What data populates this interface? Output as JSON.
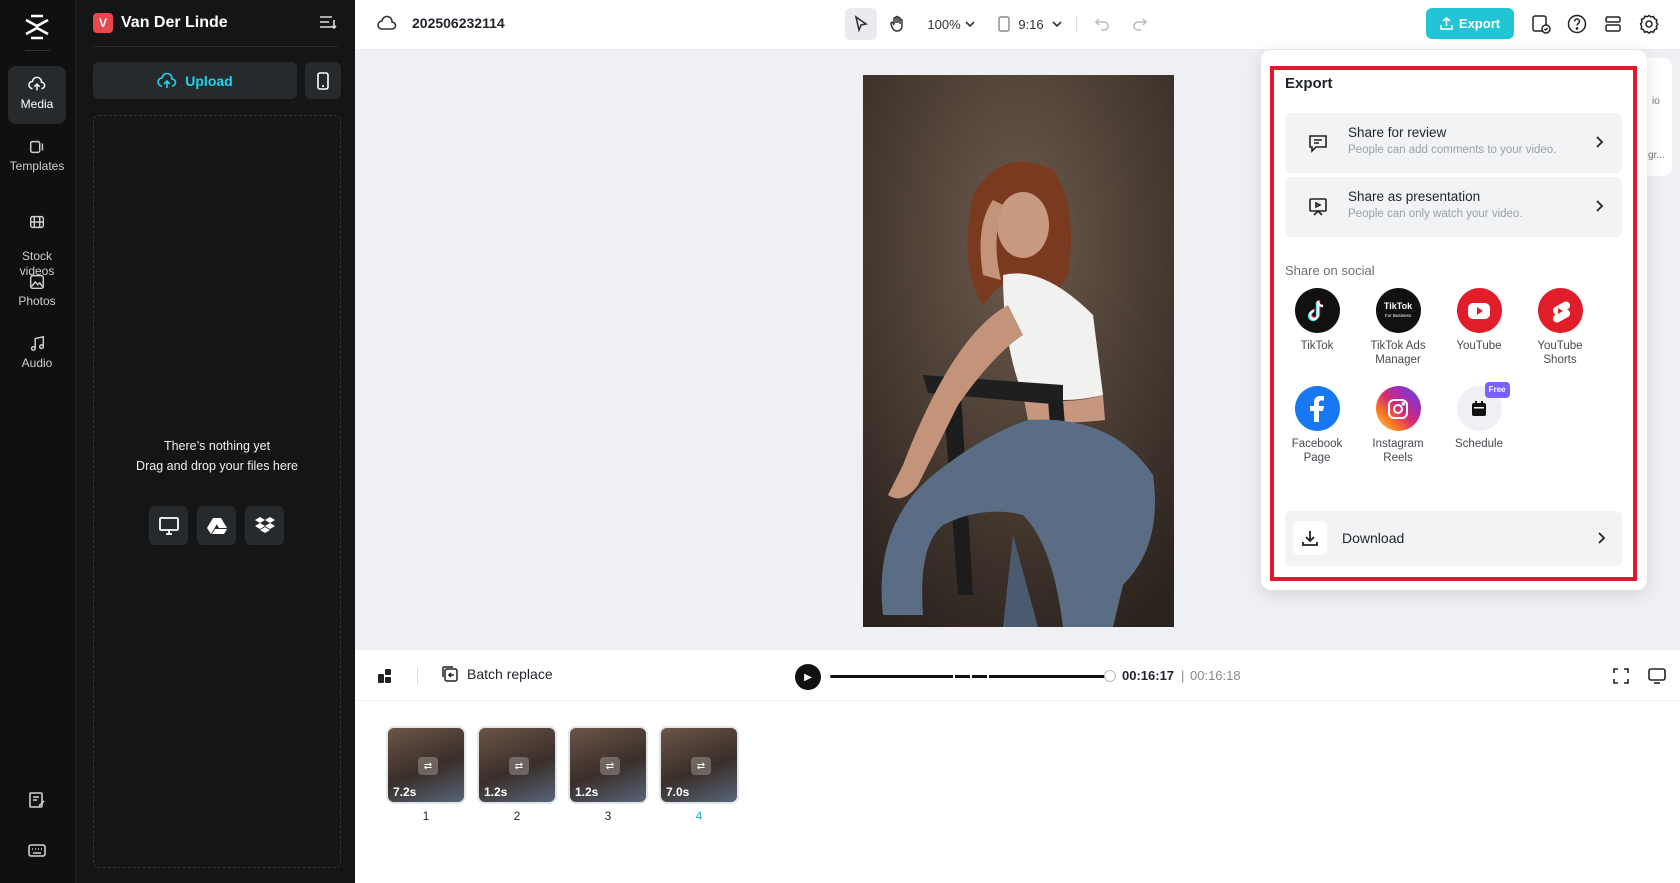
{
  "app": {
    "project_name": "Van Der Linde",
    "project_badge": "V",
    "project_id": "202506232114"
  },
  "sidebar": {
    "items": [
      {
        "label": "Media",
        "icon": "media-upload-icon",
        "active": true
      },
      {
        "label": "Templates",
        "icon": "templates-icon"
      },
      {
        "label": "Stock\nvideos",
        "icon": "film-icon"
      },
      {
        "label": "Photos",
        "icon": "image-icon"
      },
      {
        "label": "Audio",
        "icon": "music-note-icon"
      }
    ]
  },
  "media_panel": {
    "upload_label": "Upload",
    "empty_line1": "There’s nothing yet",
    "empty_line2": "Drag and drop your files here"
  },
  "toolbar": {
    "zoom": "100%",
    "aspect": "9:16",
    "export_label": "Export"
  },
  "player": {
    "batch_replace": "Batch replace",
    "current_time": "00:16:17",
    "total_time": "00:16:18"
  },
  "timeline": {
    "clips": [
      {
        "duration": "7.2s",
        "index": "1"
      },
      {
        "duration": "1.2s",
        "index": "2"
      },
      {
        "duration": "1.2s",
        "index": "3"
      },
      {
        "duration": "7.0s",
        "index": "4",
        "selected": true
      }
    ]
  },
  "side_peek": {
    "label1": "io",
    "label2": "gr..."
  },
  "export_panel": {
    "title": "Export",
    "review": {
      "title": "Share for review",
      "subtitle": "People can add comments to your video."
    },
    "presentation": {
      "title": "Share as presentation",
      "subtitle": "People can only watch your video."
    },
    "social_heading": "Share on social",
    "social": [
      {
        "label": "TikTok",
        "icon": "tiktok-icon"
      },
      {
        "label": "TikTok Ads Manager",
        "icon": "tiktok-ads-icon",
        "badge_text": "TikTok",
        "badge_sub": "For Business"
      },
      {
        "label": "YouTube",
        "icon": "youtube-icon"
      },
      {
        "label": "YouTube Shorts",
        "icon": "youtube-shorts-icon"
      },
      {
        "label": "Facebook Page",
        "icon": "facebook-icon"
      },
      {
        "label": "Instagram Reels",
        "icon": "instagram-icon"
      },
      {
        "label": "Schedule",
        "icon": "calendar-icon",
        "badge": "Free"
      }
    ],
    "download_label": "Download"
  },
  "colors": {
    "accent": "#21c5d6",
    "highlight_border": "#e3182d",
    "rail_bg": "#101010",
    "panel_bg": "#151515"
  }
}
